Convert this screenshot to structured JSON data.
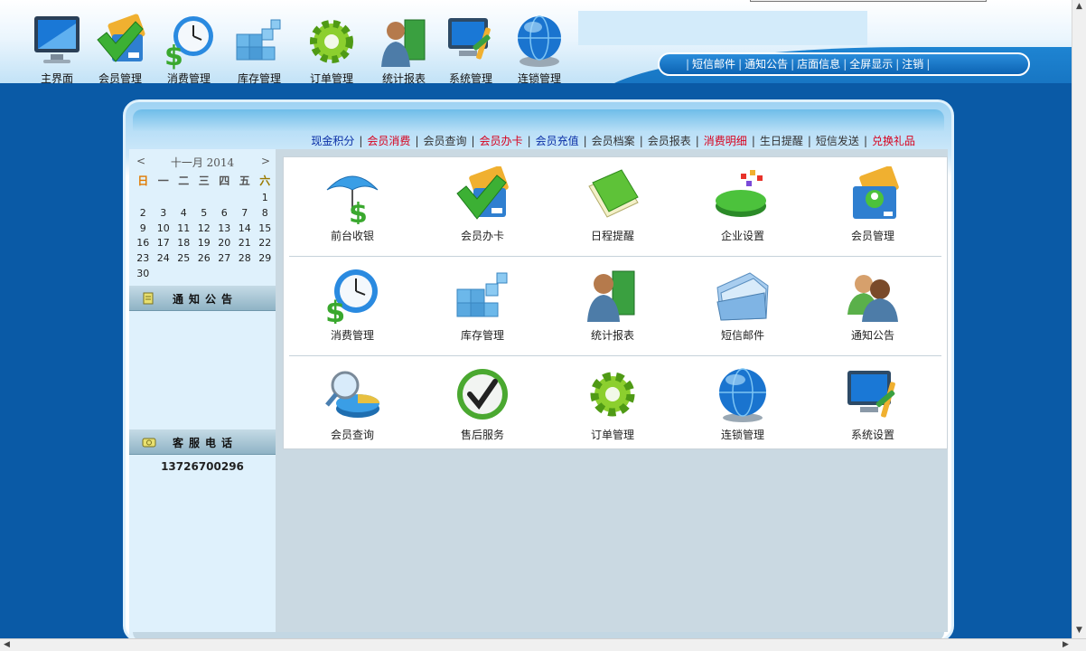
{
  "top_nav": [
    {
      "label": "主界面",
      "icon": "monitor-icon"
    },
    {
      "label": "会员管理",
      "icon": "member-card-icon"
    },
    {
      "label": "消费管理",
      "icon": "clock-dollar-icon"
    },
    {
      "label": "库存管理",
      "icon": "cubes-icon"
    },
    {
      "label": "订单管理",
      "icon": "gear-icon"
    },
    {
      "label": "统计报表",
      "icon": "person-book-icon"
    },
    {
      "label": "系统管理",
      "icon": "computer-tools-icon"
    },
    {
      "label": "连锁管理",
      "icon": "globe-icon"
    }
  ],
  "top_links": [
    "短信邮件",
    "通知公告",
    "店面信息",
    "全屏显示",
    "注销"
  ],
  "quick_links": [
    {
      "label": "现金积分",
      "color": "#0a2fa6"
    },
    {
      "label": "会员消费",
      "color": "#d8001c"
    },
    {
      "label": "会员查询",
      "color": "#333333"
    },
    {
      "label": "会员办卡",
      "color": "#d8001c"
    },
    {
      "label": "会员充值",
      "color": "#0a2fa6"
    },
    {
      "label": "会员档案",
      "color": "#333333"
    },
    {
      "label": "会员报表",
      "color": "#333333"
    },
    {
      "label": "消费明细",
      "color": "#d8001c"
    },
    {
      "label": "生日提醒",
      "color": "#333333"
    },
    {
      "label": "短信发送",
      "color": "#333333"
    },
    {
      "label": "兑换礼品",
      "color": "#d8001c"
    }
  ],
  "calendar": {
    "prev": "<",
    "next": ">",
    "title": "十一月 2014",
    "weekdays": [
      "日",
      "一",
      "二",
      "三",
      "四",
      "五",
      "六"
    ],
    "first_weekday_index": 6,
    "days": [
      "1",
      "2",
      "3",
      "4",
      "5",
      "6",
      "7",
      "8",
      "9",
      "10",
      "11",
      "12",
      "13",
      "14",
      "15",
      "16",
      "17",
      "18",
      "19",
      "20",
      "21",
      "22",
      "23",
      "24",
      "25",
      "26",
      "27",
      "28",
      "29",
      "30"
    ]
  },
  "sidebar": {
    "notice_title": "通知公告",
    "service_title": "客服电话",
    "phone": "13726700296"
  },
  "shortcuts": [
    {
      "label": "前台收银",
      "icon": "umbrella-dollar-icon"
    },
    {
      "label": "会员办卡",
      "icon": "member-card-icon"
    },
    {
      "label": "日程提醒",
      "icon": "green-book-icon"
    },
    {
      "label": "企业设置",
      "icon": "pie-chart-icon"
    },
    {
      "label": "会员管理",
      "icon": "member-profile-icon"
    },
    {
      "label": "消费管理",
      "icon": "clock-dollar-icon"
    },
    {
      "label": "库存管理",
      "icon": "cubes-icon"
    },
    {
      "label": "统计报表",
      "icon": "person-book-icon"
    },
    {
      "label": "短信邮件",
      "icon": "folder-icon"
    },
    {
      "label": "通知公告",
      "icon": "people-icon"
    },
    {
      "label": "会员查询",
      "icon": "magnifier-chart-icon"
    },
    {
      "label": "售后服务",
      "icon": "checkmark-icon"
    },
    {
      "label": "订单管理",
      "icon": "gear-icon"
    },
    {
      "label": "连锁管理",
      "icon": "globe-icon"
    },
    {
      "label": "系统设置",
      "icon": "computer-tools-icon"
    }
  ]
}
